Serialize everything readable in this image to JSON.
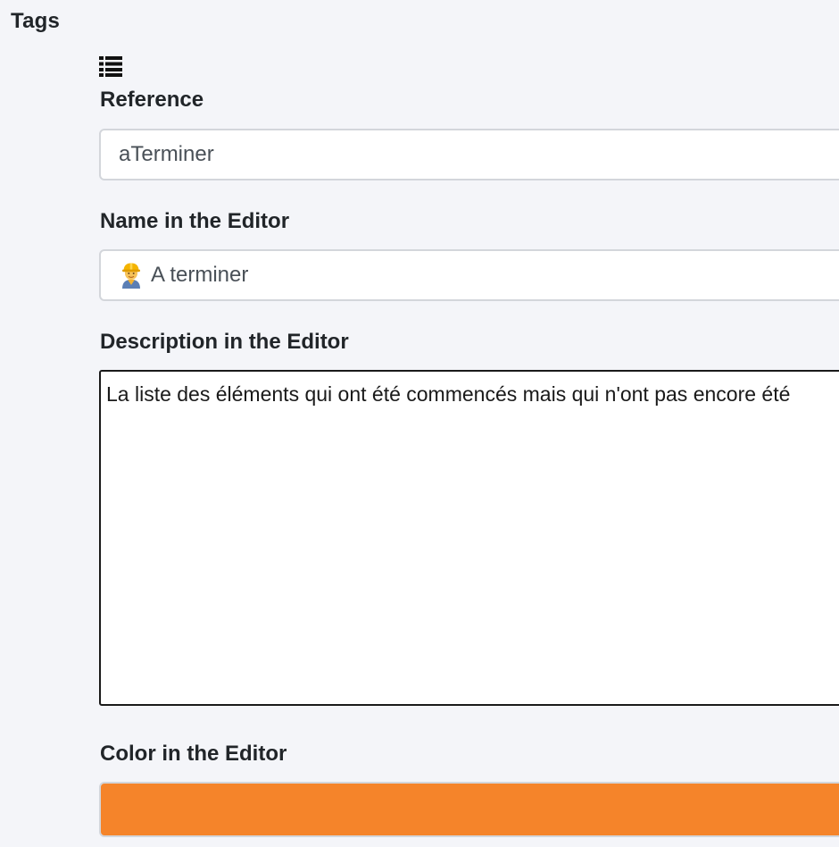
{
  "section": {
    "title": "Tags"
  },
  "icons": {
    "list": "list-icon",
    "worker": "construction-worker-icon"
  },
  "fields": {
    "reference": {
      "label": "Reference",
      "value": "aTerminer"
    },
    "name": {
      "label": "Name in the Editor",
      "value": "A terminer"
    },
    "description": {
      "label": "Description in the Editor",
      "value": "La liste des éléments qui ont été commencés mais qui n'ont pas encore été"
    },
    "color": {
      "label": "Color in the Editor",
      "value": "#f5842a"
    }
  },
  "colors": {
    "background": "#f4f5f9",
    "input_border": "#d3d6db",
    "swatch": "#f5842a"
  }
}
